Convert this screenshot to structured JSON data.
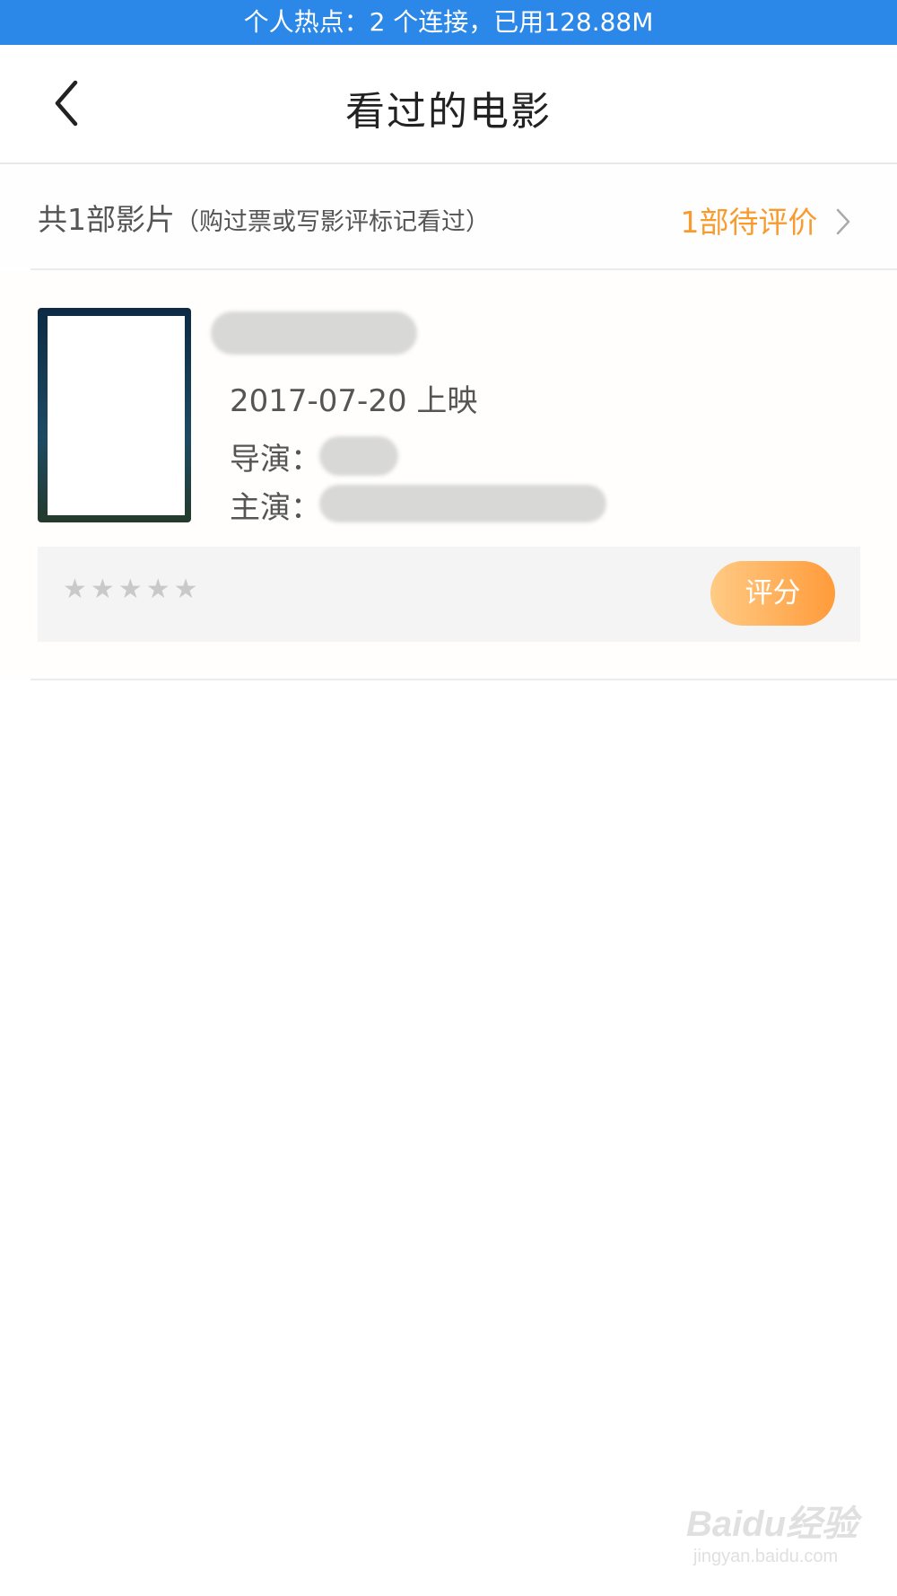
{
  "status_bar": {
    "hotspot_text": "个人热点：2 个连接，已用128.88M"
  },
  "header": {
    "title": "看过的电影",
    "back_icon": "chevron-left-icon"
  },
  "summary": {
    "count_text": "共1部影片",
    "hint_text": "（购过票或写影评标记看过）",
    "pending_text": "1部待评价",
    "pending_icon": "chevron-right-icon"
  },
  "movies": [
    {
      "release_text": "2017-07-20 上映",
      "director_label": "导演：",
      "cast_label": "主演：",
      "rating_stars": 5,
      "rate_button_label": "评分"
    }
  ],
  "colors": {
    "status_bar": "#2b87e8",
    "accent_orange": "#f89b2e",
    "rate_button_from": "#ffcb85",
    "rate_button_to": "#ff9b3a",
    "star_inactive": "#c9c9c9"
  },
  "watermark": {
    "logo_text": "Baidu经验",
    "sub_text": "jingyan.baidu.com"
  }
}
